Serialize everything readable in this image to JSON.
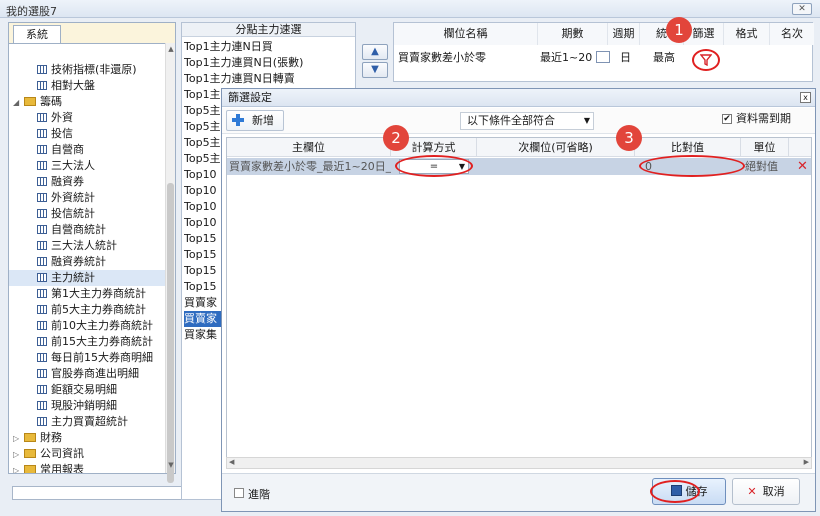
{
  "window": {
    "title": "我的選股7",
    "close_label": "✕"
  },
  "left": {
    "tab": "系統",
    "items": [
      {
        "label": "技術指標(非還原)",
        "kind": "table",
        "indent": 2
      },
      {
        "label": "相對大盤",
        "kind": "table",
        "indent": 2
      },
      {
        "label": "籌碼",
        "kind": "folder",
        "indent": 1,
        "expanded": true
      },
      {
        "label": "外資",
        "kind": "table",
        "indent": 2
      },
      {
        "label": "投信",
        "kind": "table",
        "indent": 2
      },
      {
        "label": "自營商",
        "kind": "table",
        "indent": 2
      },
      {
        "label": "三大法人",
        "kind": "table",
        "indent": 2
      },
      {
        "label": "融資券",
        "kind": "table",
        "indent": 2
      },
      {
        "label": "外資統計",
        "kind": "table",
        "indent": 2
      },
      {
        "label": "投信統計",
        "kind": "table",
        "indent": 2
      },
      {
        "label": "自營商統計",
        "kind": "table",
        "indent": 2
      },
      {
        "label": "三大法人統計",
        "kind": "table",
        "indent": 2
      },
      {
        "label": "融資券統計",
        "kind": "table",
        "indent": 2
      },
      {
        "label": "主力統計",
        "kind": "table",
        "indent": 2,
        "selected": true
      },
      {
        "label": "第1大主力券商統計",
        "kind": "table",
        "indent": 2
      },
      {
        "label": "前5大主力券商統計",
        "kind": "table",
        "indent": 2
      },
      {
        "label": "前10大主力券商統計",
        "kind": "table",
        "indent": 2
      },
      {
        "label": "前15大主力券商統計",
        "kind": "table",
        "indent": 2
      },
      {
        "label": "每日前15大券商明細",
        "kind": "table",
        "indent": 2
      },
      {
        "label": "官股券商進出明細",
        "kind": "table",
        "indent": 2
      },
      {
        "label": "鉅額交易明細",
        "kind": "table",
        "indent": 2
      },
      {
        "label": "現股沖銷明細",
        "kind": "table",
        "indent": 2
      },
      {
        "label": "主力買賣超統計",
        "kind": "table",
        "indent": 2
      },
      {
        "label": "財務",
        "kind": "folder",
        "indent": 1
      },
      {
        "label": "公司資訊",
        "kind": "folder",
        "indent": 1
      },
      {
        "label": "常用報表",
        "kind": "folder",
        "indent": 1
      }
    ]
  },
  "middle": {
    "header": "分點主力速選",
    "items": [
      "Top1主力連N日買",
      "Top1主力連買N日(張數)",
      "Top1主力連買N日轉賣",
      "Top1主",
      "Top5主",
      "Top5主",
      "Top5主",
      "Top5主",
      "Top10",
      "Top10",
      "Top10",
      "Top10",
      "Top15",
      "Top15",
      "Top15",
      "Top15",
      "買賣家",
      "買賣家",
      "買家集"
    ],
    "highlight_index": 17,
    "move_up": "▲",
    "move_down": "▼"
  },
  "columns": {
    "headers": [
      "欄位名稱",
      "期數",
      "週期",
      "統",
      "篩選",
      "格式",
      "名次"
    ],
    "row": {
      "name": "買賣家數差小於零",
      "period": "最近1~20",
      "cycle": "日",
      "stat": "最高"
    }
  },
  "badges": [
    "1",
    "2",
    "3"
  ],
  "dialog": {
    "title": "篩選設定",
    "close": "x",
    "add_label": "新增",
    "condition": "以下條件全部符合",
    "due_check_mark": "✔",
    "due_label": "資料需到期",
    "headers": [
      "主欄位",
      "計算方式",
      "次欄位(可省略)",
      "比對值",
      "單位"
    ],
    "rows": [
      {
        "main": "買賣家數差小於零_最近1~20日_...",
        "op": "=",
        "sub": "",
        "compare": "0",
        "unit": "絕對值",
        "delete": "✕"
      }
    ],
    "advanced_label": "進階",
    "save_label": "儲存",
    "cancel_label": "取消",
    "cancel_icon": "✕"
  }
}
